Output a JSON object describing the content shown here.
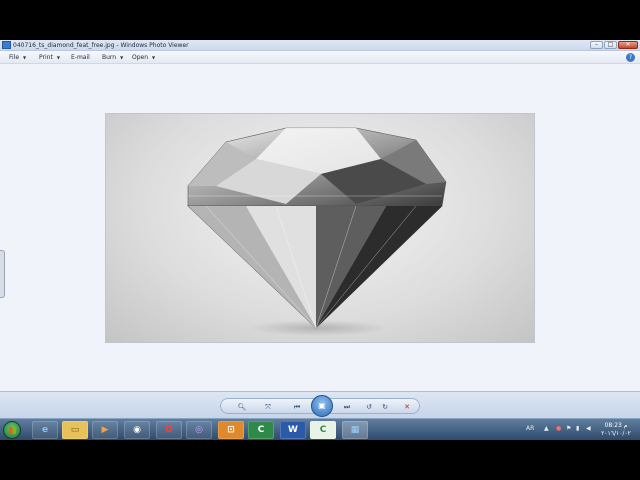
{
  "window": {
    "title": "040716_ts_diamond_feat_free.jpg - Windows Photo Viewer"
  },
  "menu": {
    "items": [
      {
        "label": "File",
        "has_arrow": true
      },
      {
        "label": "Print",
        "has_arrow": true
      },
      {
        "label": "E-mail",
        "has_arrow": false
      },
      {
        "label": "Burn",
        "has_arrow": true
      },
      {
        "label": "Open",
        "has_arrow": true
      }
    ]
  },
  "controls": {
    "zoom_icon": "magnifier-icon",
    "actual_size_icon": "fit-icon",
    "previous_icon": "previous-icon",
    "slideshow_icon": "slideshow-icon",
    "next_icon": "next-icon",
    "rotate_ccw_icon": "rotate-counterclockwise-icon",
    "rotate_cw_icon": "rotate-clockwise-icon",
    "delete_icon": "delete-icon"
  },
  "taskbar": {
    "apps": [
      "internet-explorer-icon",
      "file-explorer-icon",
      "media-player-icon",
      "chrome-icon",
      "opera-icon",
      "tor-browser-icon",
      "camtasia-recorder-icon",
      "camtasia-studio-icon",
      "word-icon",
      "camtasia-icon",
      "photo-viewer-icon"
    ],
    "tray": {
      "language": "AR",
      "time": "08:23 م",
      "date": "٢٠١٦/١٠/٠٢"
    }
  },
  "colors": {
    "accent": "#2e6db8",
    "delete": "#c0281c",
    "taskbar": "#2f4a6a"
  }
}
